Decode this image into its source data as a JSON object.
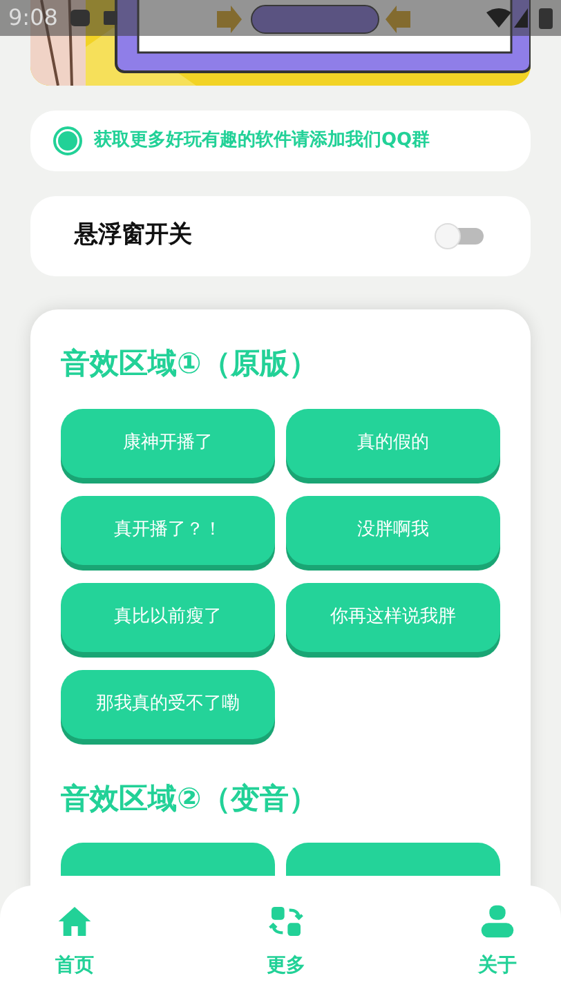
{
  "status_bar": {
    "time": "9:08"
  },
  "notice": {
    "text": "获取更多好玩有趣的软件请添加我们QQ群",
    "selected": true
  },
  "float_toggle": {
    "label": "悬浮窗开关",
    "on": false
  },
  "sections": [
    {
      "title": "音效区域①（原版）",
      "buttons": [
        {
          "kind": "labeled",
          "label": "康神开播了"
        },
        {
          "kind": "labeled",
          "label": "真的假的"
        },
        {
          "kind": "labeled",
          "label": "真开播了？！"
        },
        {
          "kind": "labeled",
          "label": "没胖啊我"
        },
        {
          "kind": "labeled",
          "label": "真比以前瘦了"
        },
        {
          "kind": "labeled",
          "label": "你再这样说我胖"
        },
        {
          "kind": "labeled",
          "label": "那我真的受不了嘞"
        }
      ]
    },
    {
      "title": "音效区域②（变音）",
      "buttons": [
        {
          "kind": "covered"
        },
        {
          "kind": "covered"
        }
      ]
    }
  ],
  "bottom_nav": [
    {
      "label": "首页"
    },
    {
      "label": "更多"
    },
    {
      "label": "关于"
    }
  ]
}
